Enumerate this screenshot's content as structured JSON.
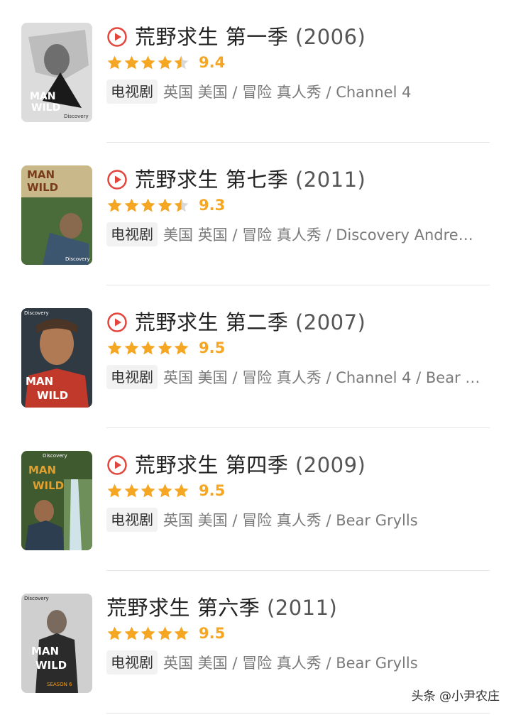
{
  "items": [
    {
      "title": "荒野求生 第一季 ",
      "year": "(2006)",
      "rating": "9.4",
      "stars": 4.5,
      "badge": "电视剧",
      "info": "英国 美国 / 冒险 真人秀 / Channel 4",
      "has_play": true
    },
    {
      "title": "荒野求生 第七季 ",
      "year": "(2011)",
      "rating": "9.3",
      "stars": 4.5,
      "badge": "电视剧",
      "info": "美国 英国 / 冒险 真人秀 / Discovery Andre…",
      "has_play": true
    },
    {
      "title": "荒野求生  第二季 ",
      "year": "(2007)",
      "rating": "9.5",
      "stars": 5,
      "badge": "电视剧",
      "info": "英国 美国 / 冒险 真人秀 / Channel 4 / Bear …",
      "has_play": true
    },
    {
      "title": "荒野求生  第四季 ",
      "year": "(2009)",
      "rating": "9.5",
      "stars": 5,
      "badge": "电视剧",
      "info": "英国 美国 / 冒险 真人秀 / Bear Grylls",
      "has_play": true
    },
    {
      "title": "荒野求生  第六季 ",
      "year": "(2011)",
      "rating": "9.5",
      "stars": 5,
      "badge": "电视剧",
      "info": "英国 美国 / 冒险 真人秀 / Bear Grylls",
      "has_play": false
    }
  ],
  "watermark": "头条 @小尹农庄",
  "colors": {
    "star": "#f5a623",
    "star_empty": "#d9d9d9",
    "play": "#e2453c"
  }
}
